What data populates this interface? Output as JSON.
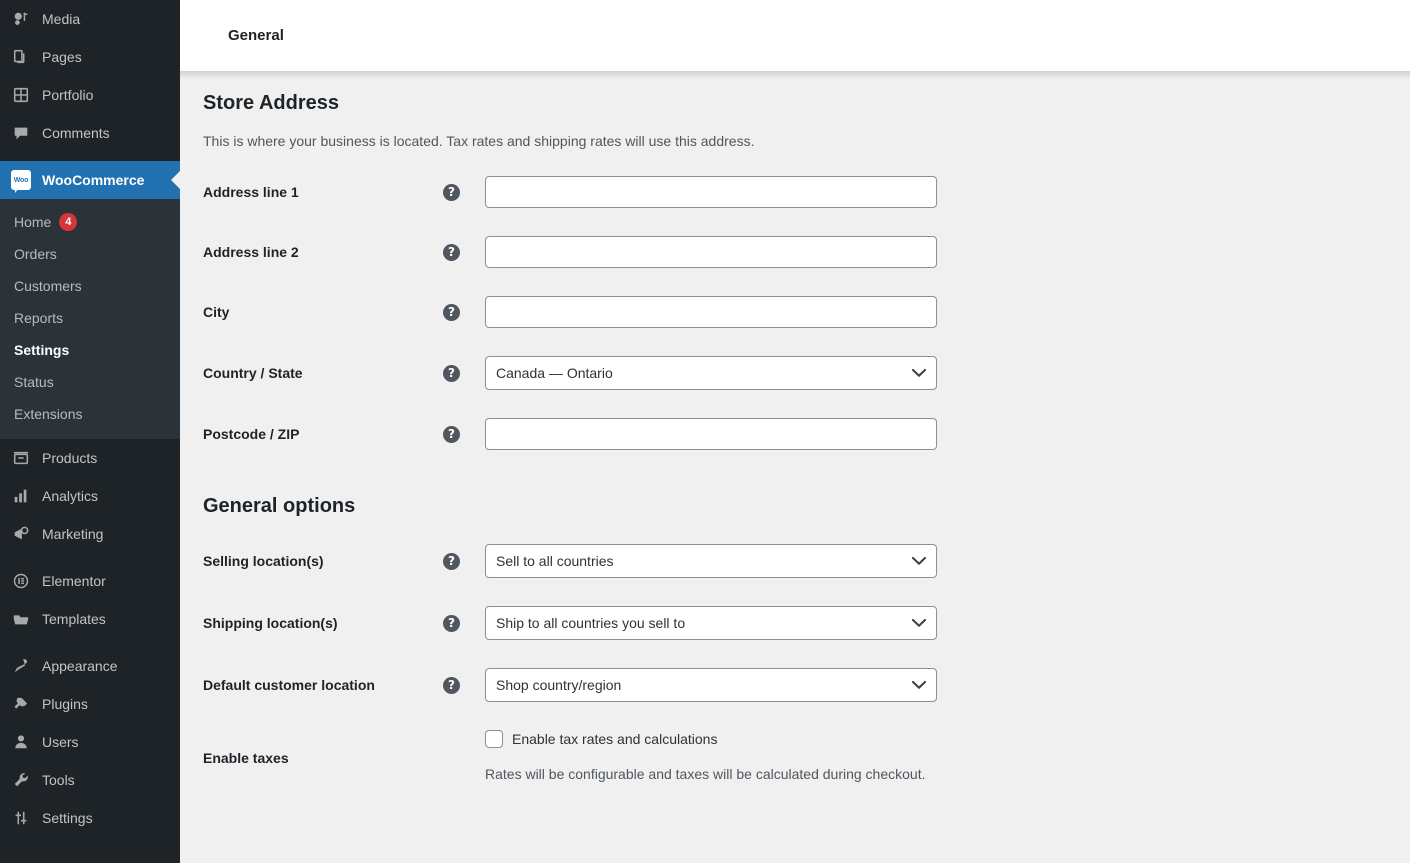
{
  "sidebar": {
    "items": [
      {
        "label": "Media",
        "icon": "media-icon",
        "type": "item"
      },
      {
        "label": "Pages",
        "icon": "pages-icon",
        "type": "item"
      },
      {
        "label": "Portfolio",
        "icon": "portfolio-icon",
        "type": "item"
      },
      {
        "label": "Comments",
        "icon": "comments-icon",
        "type": "item"
      },
      {
        "label": "WooCommerce",
        "icon": "woocommerce-icon",
        "type": "current"
      },
      {
        "label": "Products",
        "icon": "products-icon",
        "type": "item"
      },
      {
        "label": "Analytics",
        "icon": "analytics-icon",
        "type": "item"
      },
      {
        "label": "Marketing",
        "icon": "marketing-icon",
        "type": "item"
      },
      {
        "label": "Elementor",
        "icon": "elementor-icon",
        "type": "item"
      },
      {
        "label": "Templates",
        "icon": "templates-icon",
        "type": "item"
      },
      {
        "label": "Appearance",
        "icon": "appearance-icon",
        "type": "item"
      },
      {
        "label": "Plugins",
        "icon": "plugins-icon",
        "type": "item"
      },
      {
        "label": "Users",
        "icon": "users-icon",
        "type": "item"
      },
      {
        "label": "Tools",
        "icon": "tools-icon",
        "type": "item"
      },
      {
        "label": "Settings",
        "icon": "settings-icon",
        "type": "item"
      }
    ],
    "submenu": [
      {
        "label": "Home",
        "badge": "4",
        "active": false
      },
      {
        "label": "Orders",
        "badge": null,
        "active": false
      },
      {
        "label": "Customers",
        "badge": null,
        "active": false
      },
      {
        "label": "Reports",
        "badge": null,
        "active": false
      },
      {
        "label": "Settings",
        "badge": null,
        "active": true
      },
      {
        "label": "Status",
        "badge": null,
        "active": false
      },
      {
        "label": "Extensions",
        "badge": null,
        "active": false
      }
    ],
    "colors": {
      "background": "#1d2327",
      "submenu_background": "#2c3338",
      "current_item": "#2271b1",
      "badge": "#d63638"
    }
  },
  "header": {
    "tab_label": "General"
  },
  "store_address": {
    "title": "Store Address",
    "description": "This is where your business is located. Tax rates and shipping rates will use this address.",
    "fields": [
      {
        "label": "Address line 1",
        "kind": "text",
        "value": "",
        "help": "?"
      },
      {
        "label": "Address line 2",
        "kind": "text",
        "value": "",
        "help": "?"
      },
      {
        "label": "City",
        "kind": "text",
        "value": "",
        "help": "?"
      },
      {
        "label": "Country / State",
        "kind": "select",
        "value": "Canada — Ontario",
        "help": "?"
      },
      {
        "label": "Postcode / ZIP",
        "kind": "text",
        "value": "",
        "help": "?"
      }
    ]
  },
  "general_options": {
    "title": "General options",
    "fields": [
      {
        "label": "Selling location(s)",
        "kind": "select",
        "value": "Sell to all countries",
        "help": "?"
      },
      {
        "label": "Shipping location(s)",
        "kind": "select",
        "value": "Ship to all countries you sell to",
        "help": "?"
      },
      {
        "label": "Default customer location",
        "kind": "select",
        "value": "Shop country/region",
        "help": "?"
      },
      {
        "label": "Enable taxes",
        "kind": "checkbox",
        "value": "Enable tax rates and calculations",
        "checked": false,
        "note": "Rates will be configurable and taxes will be calculated during checkout.",
        "help": null
      }
    ]
  }
}
